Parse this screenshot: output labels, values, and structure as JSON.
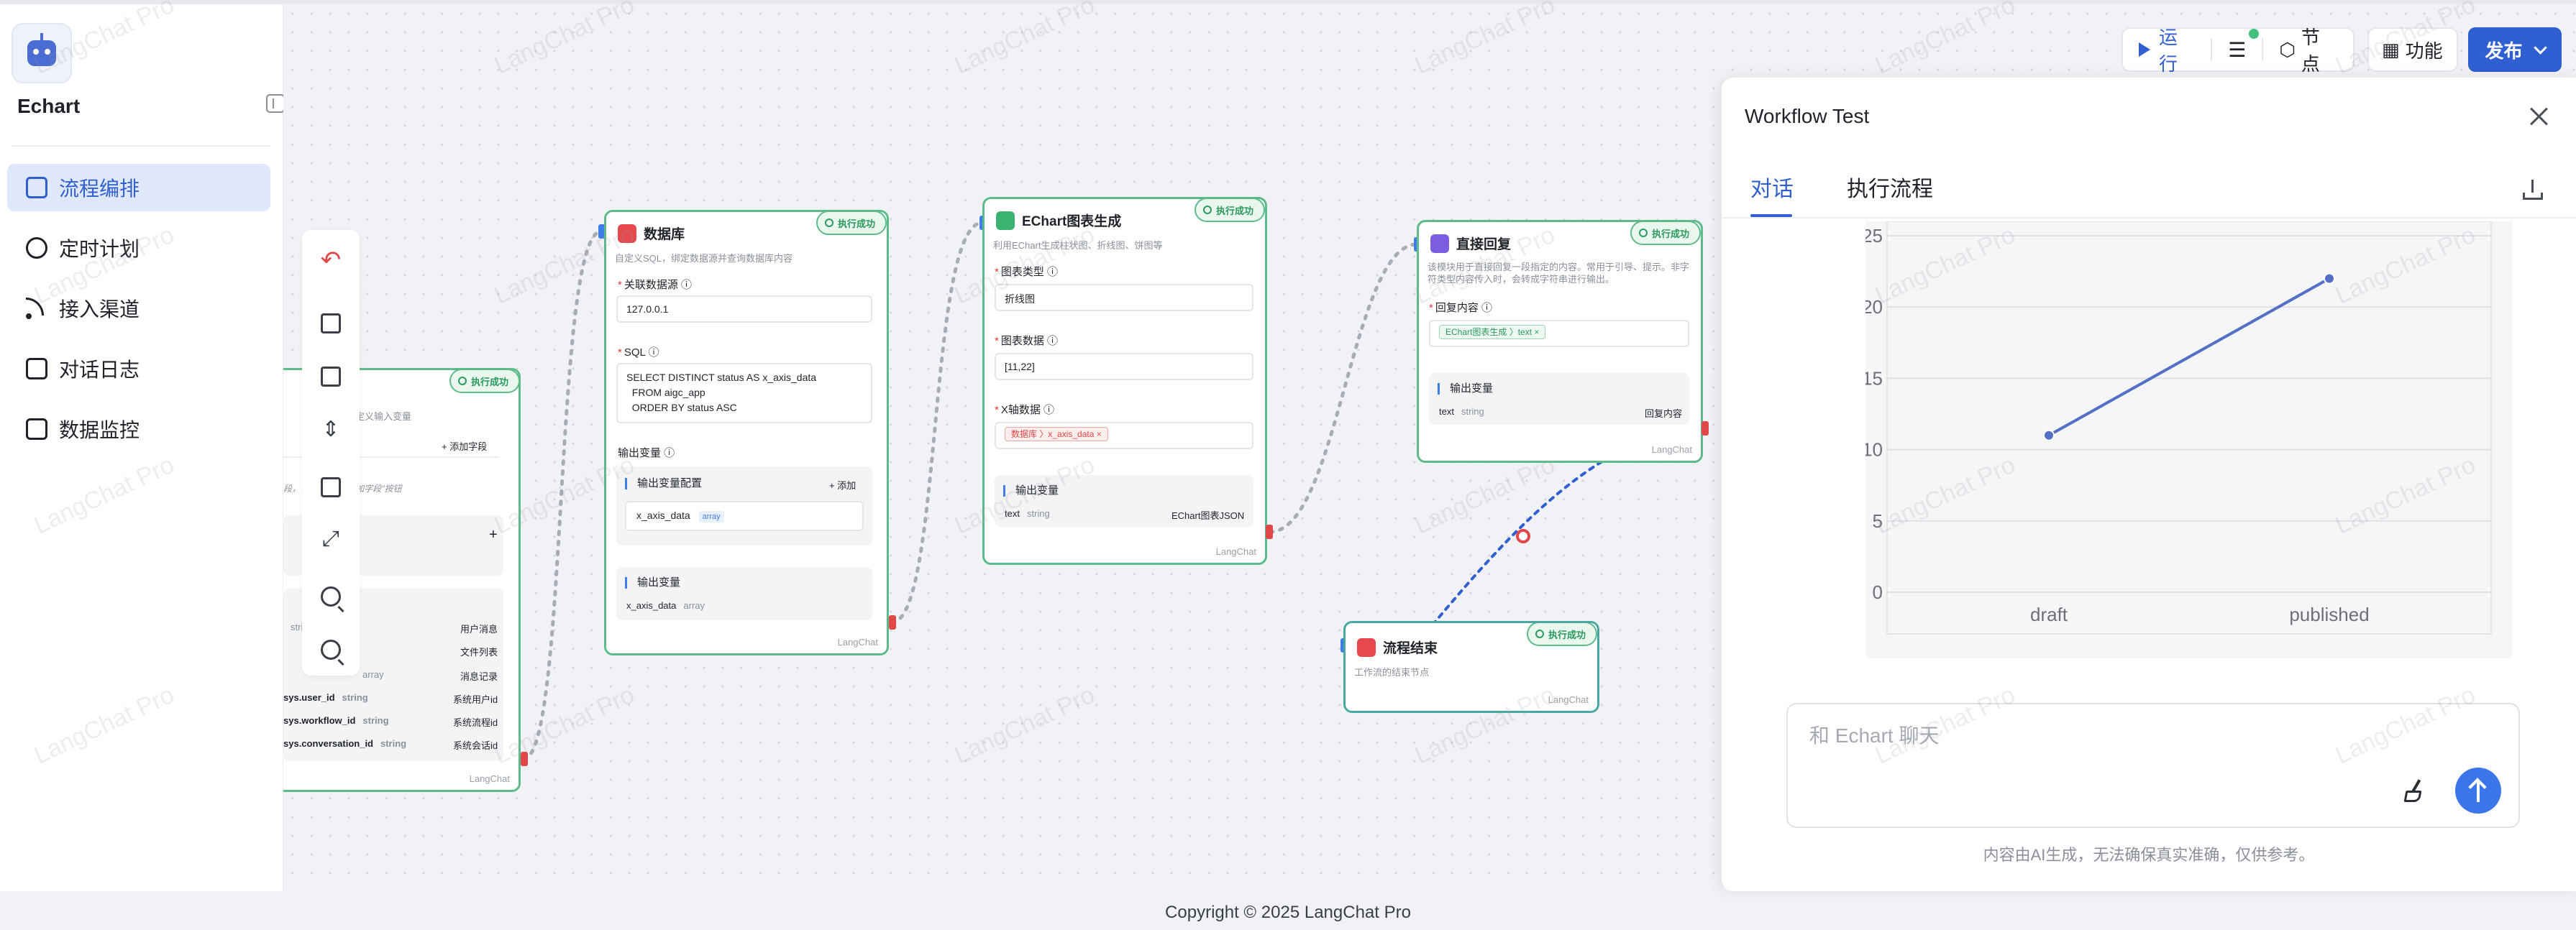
{
  "app": {
    "name": "Echart"
  },
  "sidebar": {
    "items": [
      {
        "label": "流程编排",
        "icon": "workflow-icon",
        "active": true
      },
      {
        "label": "定时计划",
        "icon": "clock-icon",
        "active": false
      },
      {
        "label": "接入渠道",
        "icon": "rss-icon",
        "active": false
      },
      {
        "label": "对话日志",
        "icon": "log-icon",
        "active": false
      },
      {
        "label": "数据监控",
        "icon": "monitor-icon",
        "active": false
      }
    ]
  },
  "topbar": {
    "run": "运行",
    "nodes": "节点",
    "features": "功能",
    "publish": "发布"
  },
  "nodes": {
    "start": {
      "badge": "执行成功",
      "desc": "定义输入变量",
      "add_field": "+ 添加字段",
      "hint": "段，请点击上方\"添加字段\"按钮",
      "vars": [
        {
          "name": "",
          "type": "string",
          "desc": "用户消息"
        },
        {
          "name": "",
          "type": "",
          "desc": "文件列表"
        },
        {
          "name": "",
          "type": "array",
          "desc": "消息记录"
        },
        {
          "name": "sys.user_id",
          "type": "string",
          "desc": "系统用户id"
        },
        {
          "name": "sys.workflow_id",
          "type": "string",
          "desc": "系统流程id"
        },
        {
          "name": "sys.conversation_id",
          "type": "string",
          "desc": "系统会话id"
        }
      ],
      "footer": "LangChat"
    },
    "database": {
      "title": "数据库",
      "badge": "执行成功",
      "desc": "自定义SQL，绑定数据源并查询数据库内容",
      "ds_label": "关联数据源",
      "ds_value": "127.0.0.1",
      "sql_label": "SQL",
      "sql_lines": [
        "SELECT DISTINCT status AS x_axis_data",
        "  FROM aigc_app",
        "  ORDER BY status ASC"
      ],
      "out_label": "输出变量",
      "out_config": "输出变量配置",
      "add": "+ 添加",
      "out_var": "x_axis_data",
      "out_var_type": "array",
      "out_section": "输出变量",
      "out_result": "x_axis_data",
      "out_result_type": "array",
      "footer": "LangChat"
    },
    "echart": {
      "title": "EChart图表生成",
      "badge": "执行成功",
      "desc": "利用EChart生成柱状图、折线图、饼图等",
      "type_label": "图表类型",
      "type_value": "折线图",
      "data_label": "图表数据",
      "data_value": "[11,22]",
      "x_label": "X轴数据",
      "x_tag_node": "数据库",
      "x_tag_var": "x_axis_data",
      "out_section": "输出变量",
      "out_name": "text",
      "out_type": "string",
      "out_desc": "EChart图表JSON",
      "footer": "LangChat"
    },
    "reply": {
      "title": "直接回复",
      "badge": "执行成功",
      "desc_line1": "该模块用于直接回复一段指定的内容。常用于引导、提示。非字",
      "desc_line2": "符类型内容传入时，会转成字符串进行输出。",
      "content_label": "回复内容",
      "tag_node": "EChart图表生成",
      "tag_var": "text",
      "out_section": "输出变量",
      "out_name": "text",
      "out_type": "string",
      "out_desc": "回复内容",
      "footer": "LangChat"
    },
    "end": {
      "title": "流程结束",
      "badge": "执行成功",
      "desc": "工作流的结束节点",
      "footer": "LangChat"
    }
  },
  "panel": {
    "title": "Workflow Test",
    "tabs": [
      "对话",
      "执行流程"
    ],
    "placeholder": "和 Echart 聊天",
    "disclaimer": "内容由AI生成，无法确保真实准确，仅供参考。"
  },
  "chart_data": {
    "type": "line",
    "categories": [
      "draft",
      "published"
    ],
    "values": [
      11,
      22
    ],
    "yticks": [
      "0",
      "5",
      "10",
      "15",
      "20",
      "25"
    ],
    "ylim": [
      0,
      25
    ],
    "color": "#5470c6"
  },
  "footer": {
    "copyright": "Copyright © 2025 LangChat Pro"
  },
  "watermark": "LangChat Pro"
}
